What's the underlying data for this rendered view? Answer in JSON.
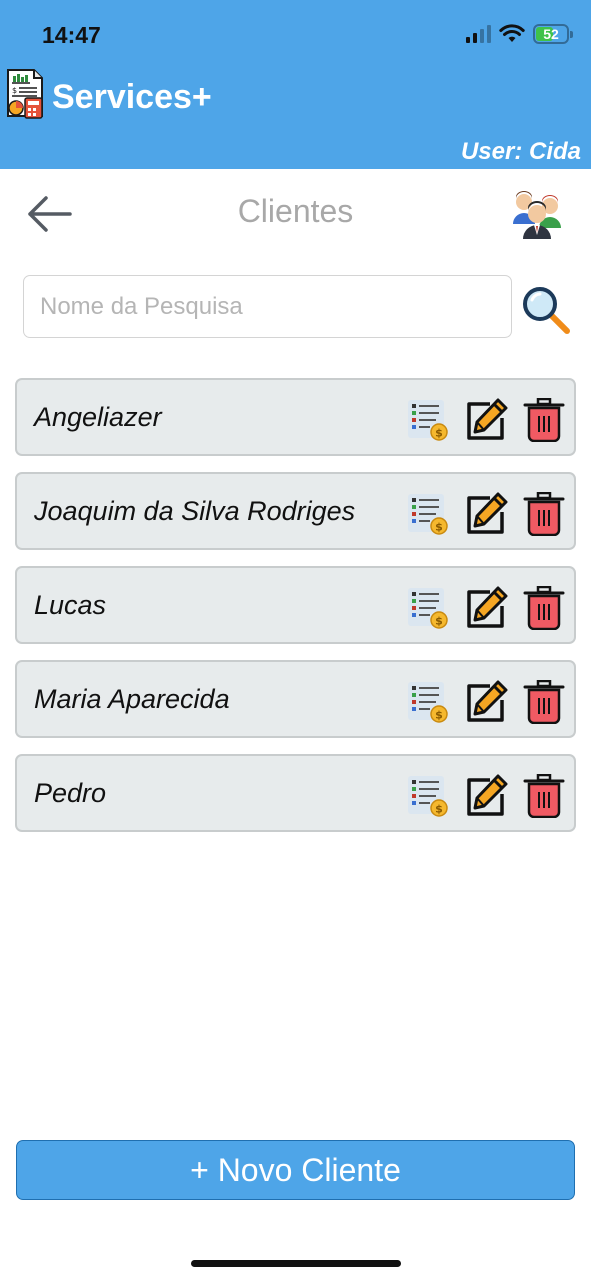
{
  "status_bar": {
    "time": "14:47",
    "battery": "52"
  },
  "header": {
    "app_title": "Services+",
    "user_label": "User: Cida"
  },
  "page": {
    "title": "Clientes"
  },
  "search": {
    "placeholder": "Nome da Pesquisa"
  },
  "clients": [
    {
      "name": "Angeliazer"
    },
    {
      "name": "Joaquim da Silva Rodriges"
    },
    {
      "name": "Lucas"
    },
    {
      "name": "Maria Aparecida"
    },
    {
      "name": "Pedro"
    }
  ],
  "actions": {
    "new_client_label": "+ Novo Cliente"
  },
  "icons": {
    "app_logo": "invoice-calculator-icon",
    "back": "arrow-left-icon",
    "clients": "group-users-icon",
    "search": "magnifier-icon",
    "finance": "bill-coin-icon",
    "edit": "pencil-edit-icon",
    "delete": "trash-icon"
  },
  "colors": {
    "header": "#4ea5e8",
    "row_background": "#e7ebec",
    "delete_red": "#f05a63",
    "edit_orange": "#f5a623",
    "battery_green": "#3fc24a"
  }
}
